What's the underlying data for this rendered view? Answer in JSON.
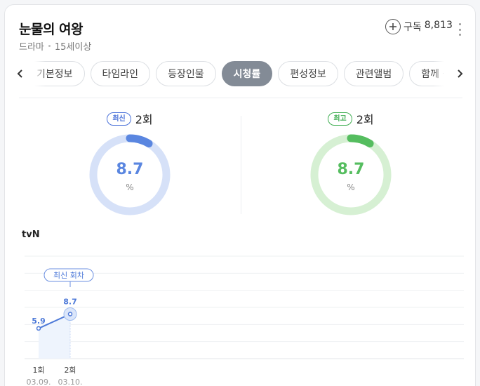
{
  "header": {
    "title": "눈물의 여왕",
    "genre": "드라마",
    "age": "15세이상",
    "subscribe_label": "구독",
    "subscribe_count": "8,813"
  },
  "tabs": [
    {
      "label": "기본정보",
      "active": false
    },
    {
      "label": "타임라인",
      "active": false
    },
    {
      "label": "등장인물",
      "active": false
    },
    {
      "label": "시청률",
      "active": true
    },
    {
      "label": "편성정보",
      "active": false
    },
    {
      "label": "관련앨범",
      "active": false
    },
    {
      "label": "함께 볼만한",
      "active": false
    }
  ],
  "ratings": {
    "latest": {
      "badge": "최신",
      "episode": "2회",
      "value": "8.7",
      "unit": "%",
      "fraction": 0.087,
      "color": "#5a86e0",
      "track": "#d6e1f8"
    },
    "highest": {
      "badge": "최고",
      "episode": "2회",
      "value": "8.7",
      "unit": "%",
      "fraction": 0.087,
      "color": "#55bd5f",
      "track": "#d6f0d3"
    }
  },
  "channel": "tvN",
  "chart_data": {
    "type": "line",
    "categories": [
      "1회",
      "2회"
    ],
    "dates": [
      "03.09.",
      "03.10."
    ],
    "values": [
      5.9,
      8.7
    ],
    "value_labels": [
      "5.9",
      "8.7"
    ],
    "callout": "최신 회차",
    "ylim": [
      0,
      20
    ],
    "grid": true,
    "color": "#4d79d8"
  }
}
